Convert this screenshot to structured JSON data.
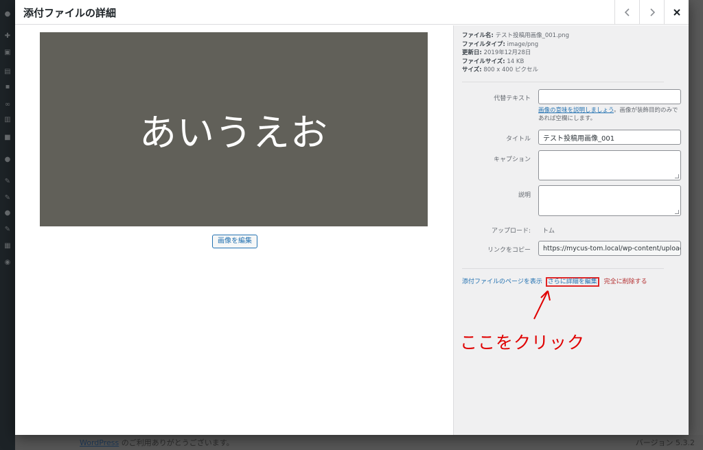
{
  "backdrop": {
    "footer_link": "WordPress",
    "footer_text": " のご利用ありがとうございます。",
    "footer_version": "バージョン 5.3.2"
  },
  "modal": {
    "title": "添付ファイルの詳細",
    "prev_icon": "chevron-left-icon",
    "next_icon": "chevron-right-icon",
    "close_icon": "close-icon"
  },
  "preview": {
    "image_text": "あいうえお",
    "image_bg": "#616059",
    "edit_button": "画像を編集"
  },
  "file_info": [
    {
      "label": "ファイル名:",
      "value": "テスト投稿用画像_001.png"
    },
    {
      "label": "ファイルタイプ:",
      "value": "image/png"
    },
    {
      "label": "更新日:",
      "value": "2019年12月28日"
    },
    {
      "label": "ファイルサイズ:",
      "value": "14 KB"
    },
    {
      "label": "サイズ:",
      "value": "800 x 400 ピクセル"
    }
  ],
  "fields": {
    "alt_label": "代替テキスト",
    "alt_value": "",
    "alt_help_link": "画像の意味を説明しましょう",
    "alt_help_text": "。画像が装飾目的のみであれば空欄にします。",
    "title_label": "タイトル",
    "title_value": "テスト投稿用画像_001",
    "caption_label": "キャプション",
    "caption_value": "",
    "description_label": "説明",
    "description_value": "",
    "uploaded_by_label": "アップロード:",
    "uploaded_by_value": "トム",
    "copy_link_label": "リンクをコピー",
    "copy_link_value": "https://mycus-tom.local/wp-content/uploads"
  },
  "actions": {
    "view_page": "添付ファイルのページを表示",
    "edit_more": "さらに詳細を編集",
    "delete": "完全に削除する"
  },
  "annotation": {
    "text": "ここをクリック",
    "color": "#e00000"
  }
}
